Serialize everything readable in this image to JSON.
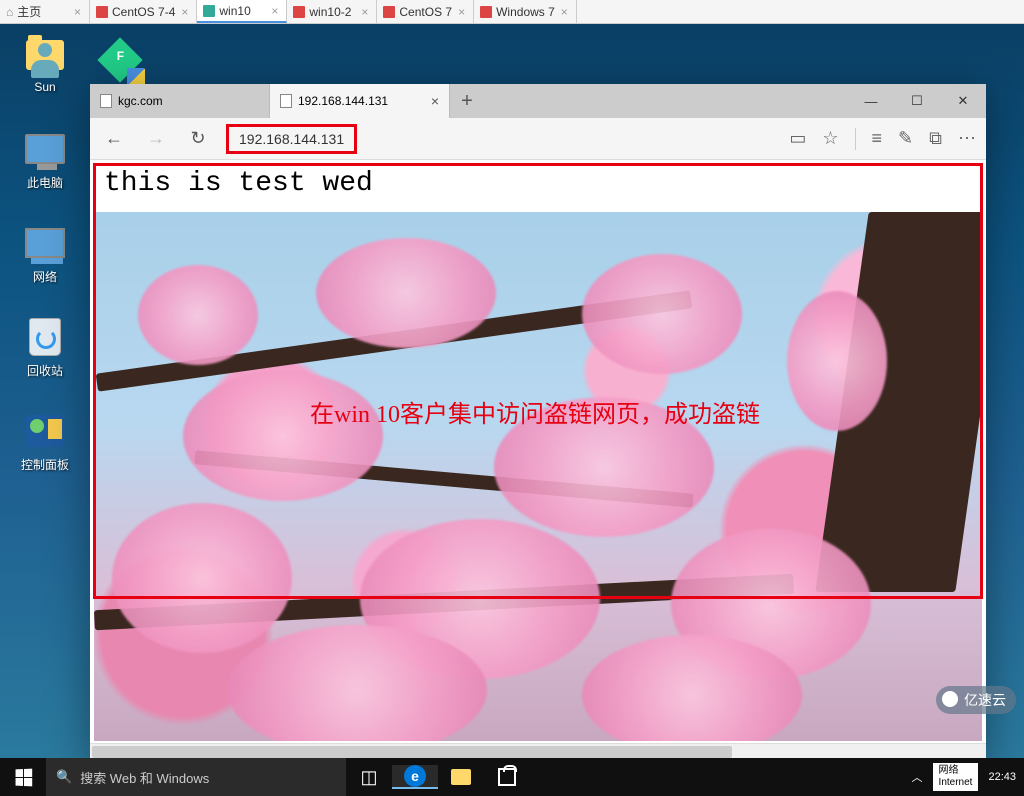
{
  "vm_tabs": [
    {
      "label": "主页",
      "type": "home"
    },
    {
      "label": "CentOS 7-4",
      "type": "vm"
    },
    {
      "label": "win10",
      "type": "vm",
      "active": true
    },
    {
      "label": "win10-2",
      "type": "vm"
    },
    {
      "label": "CentOS 7",
      "type": "vm"
    },
    {
      "label": "Windows 7",
      "type": "vm"
    }
  ],
  "desktop_icons": {
    "user": "Sun",
    "pc": "此电脑",
    "network": "网络",
    "recycle": "回收站",
    "control": "控制面板"
  },
  "browser": {
    "tabs": [
      {
        "title": "kgc.com"
      },
      {
        "title": "192.168.144.131",
        "active": true
      }
    ],
    "address": "192.168.144.131",
    "page_heading": "this is test wed"
  },
  "annotation": "在win 10客户集中访问盗链网页，成功盗链",
  "taskbar": {
    "search_placeholder": "搜索 Web 和 Windows",
    "tray_label1": "网络",
    "tray_label2": "Internet",
    "time": "22:43"
  },
  "watermark": "亿速云"
}
